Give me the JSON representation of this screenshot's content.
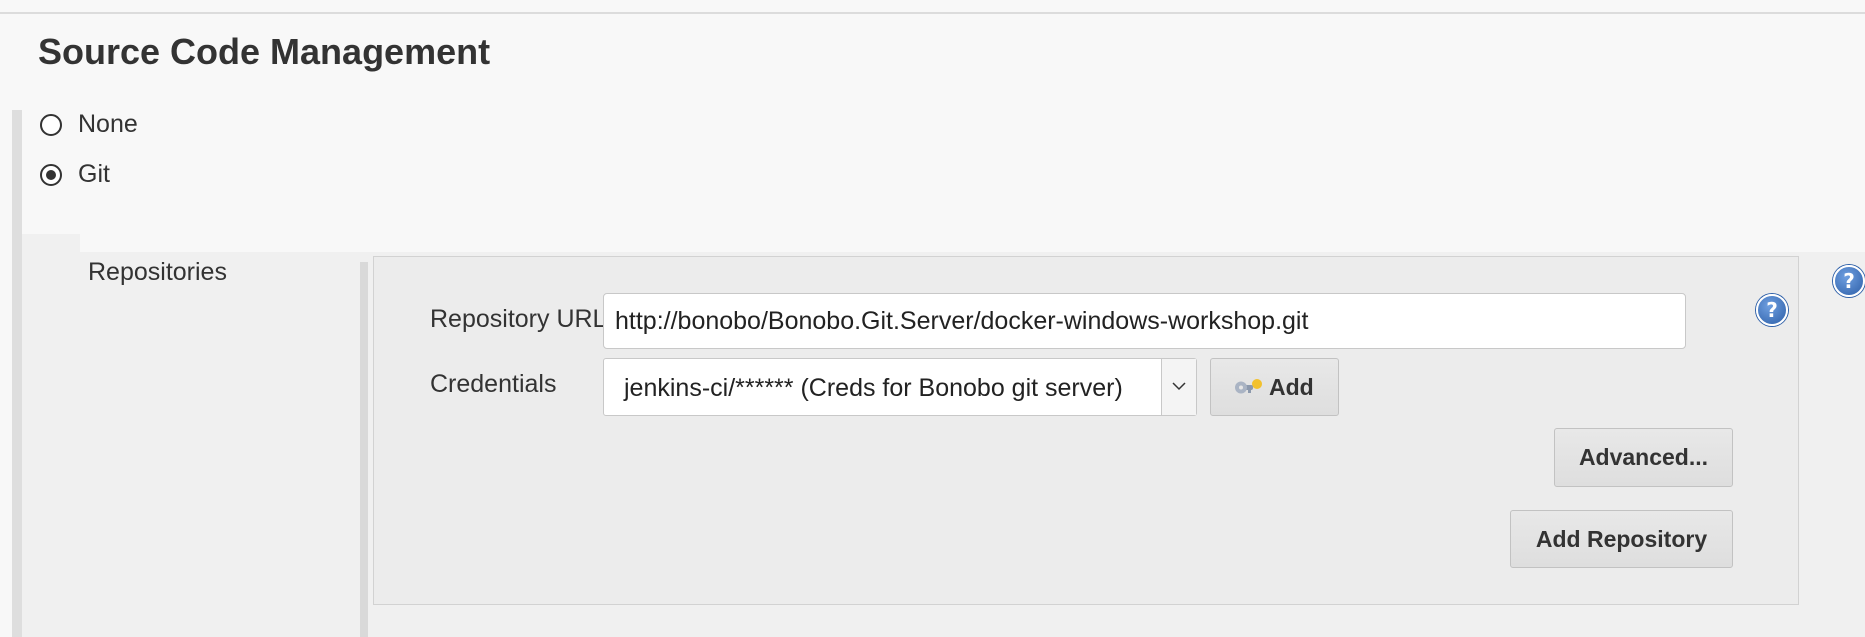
{
  "section": {
    "title": "Source Code Management"
  },
  "scm_options": [
    {
      "label": "None",
      "selected": false
    },
    {
      "label": "Git",
      "selected": true
    }
  ],
  "git": {
    "repositories_label": "Repositories",
    "help_icon_glyph": "?",
    "repository_url": {
      "label": "Repository URL",
      "value": "http://bonobo/Bonobo.Git.Server/docker-windows-workshop.git"
    },
    "credentials": {
      "label": "Credentials",
      "selected": "jenkins-ci/****** (Creds for Bonobo git server)"
    },
    "buttons": {
      "add_credentials": "Add",
      "advanced": "Advanced...",
      "add_repository": "Add Repository"
    }
  },
  "icons": {
    "help": "help-icon",
    "credentials_add": "key-icon",
    "dropdown": "chevron-down-icon"
  },
  "colors": {
    "help_icon": "#2d5fa8",
    "panel_background": "#ececec",
    "page_background": "#f8f8f8"
  }
}
